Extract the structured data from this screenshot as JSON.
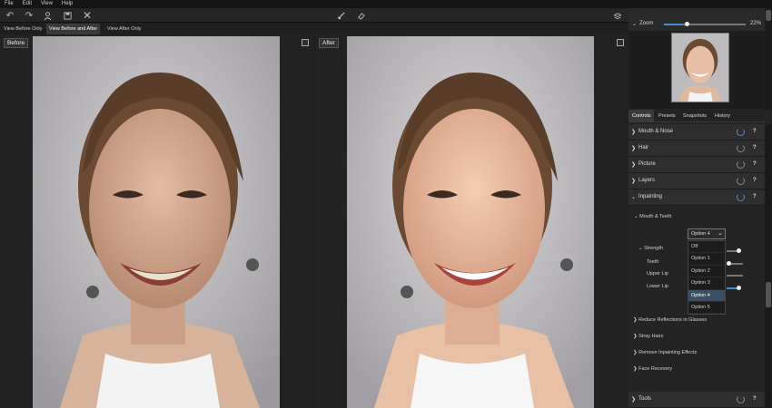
{
  "menu": [
    "File",
    "Edit",
    "View",
    "Help"
  ],
  "view_tabs": [
    "View Before Only",
    "View Before and After",
    "View After Only"
  ],
  "active_view_tab": 1,
  "panes": {
    "before_label": "Before",
    "after_label": "After"
  },
  "zoom": {
    "label": "Zoom",
    "value": "22%",
    "level": 0.22
  },
  "panel_tabs": [
    "Controls",
    "Presets",
    "Snapshots",
    "History"
  ],
  "sections": {
    "mouth_nose": "Mouth & Nose",
    "hair": "Hair",
    "picture": "Picture",
    "layers": "Layers",
    "inpainting": "Inpainting",
    "tools": "Tools"
  },
  "inpainting": {
    "mouth_teeth": "Mouth & Teeth",
    "strength": "Strength",
    "teeth": "Teeth",
    "upper_lip": "Upper Lip",
    "lower_lip": "Lower Lip",
    "reduce_reflections": "Reduce Reflections in Glasses",
    "stray_hairs": "Stray Hairs",
    "remove_effects": "Remove Inpainting Effects",
    "face_recovery": "Face Recovery"
  },
  "dropdown": {
    "selected": "Option 4",
    "options": [
      "Off",
      "Option 1",
      "Option 2",
      "Option 3",
      "Option 4",
      "Option 5"
    ]
  },
  "colors": {
    "accent": "#4a8bd0",
    "panel": "#2e2e2e",
    "background": "#1e1e1e"
  }
}
